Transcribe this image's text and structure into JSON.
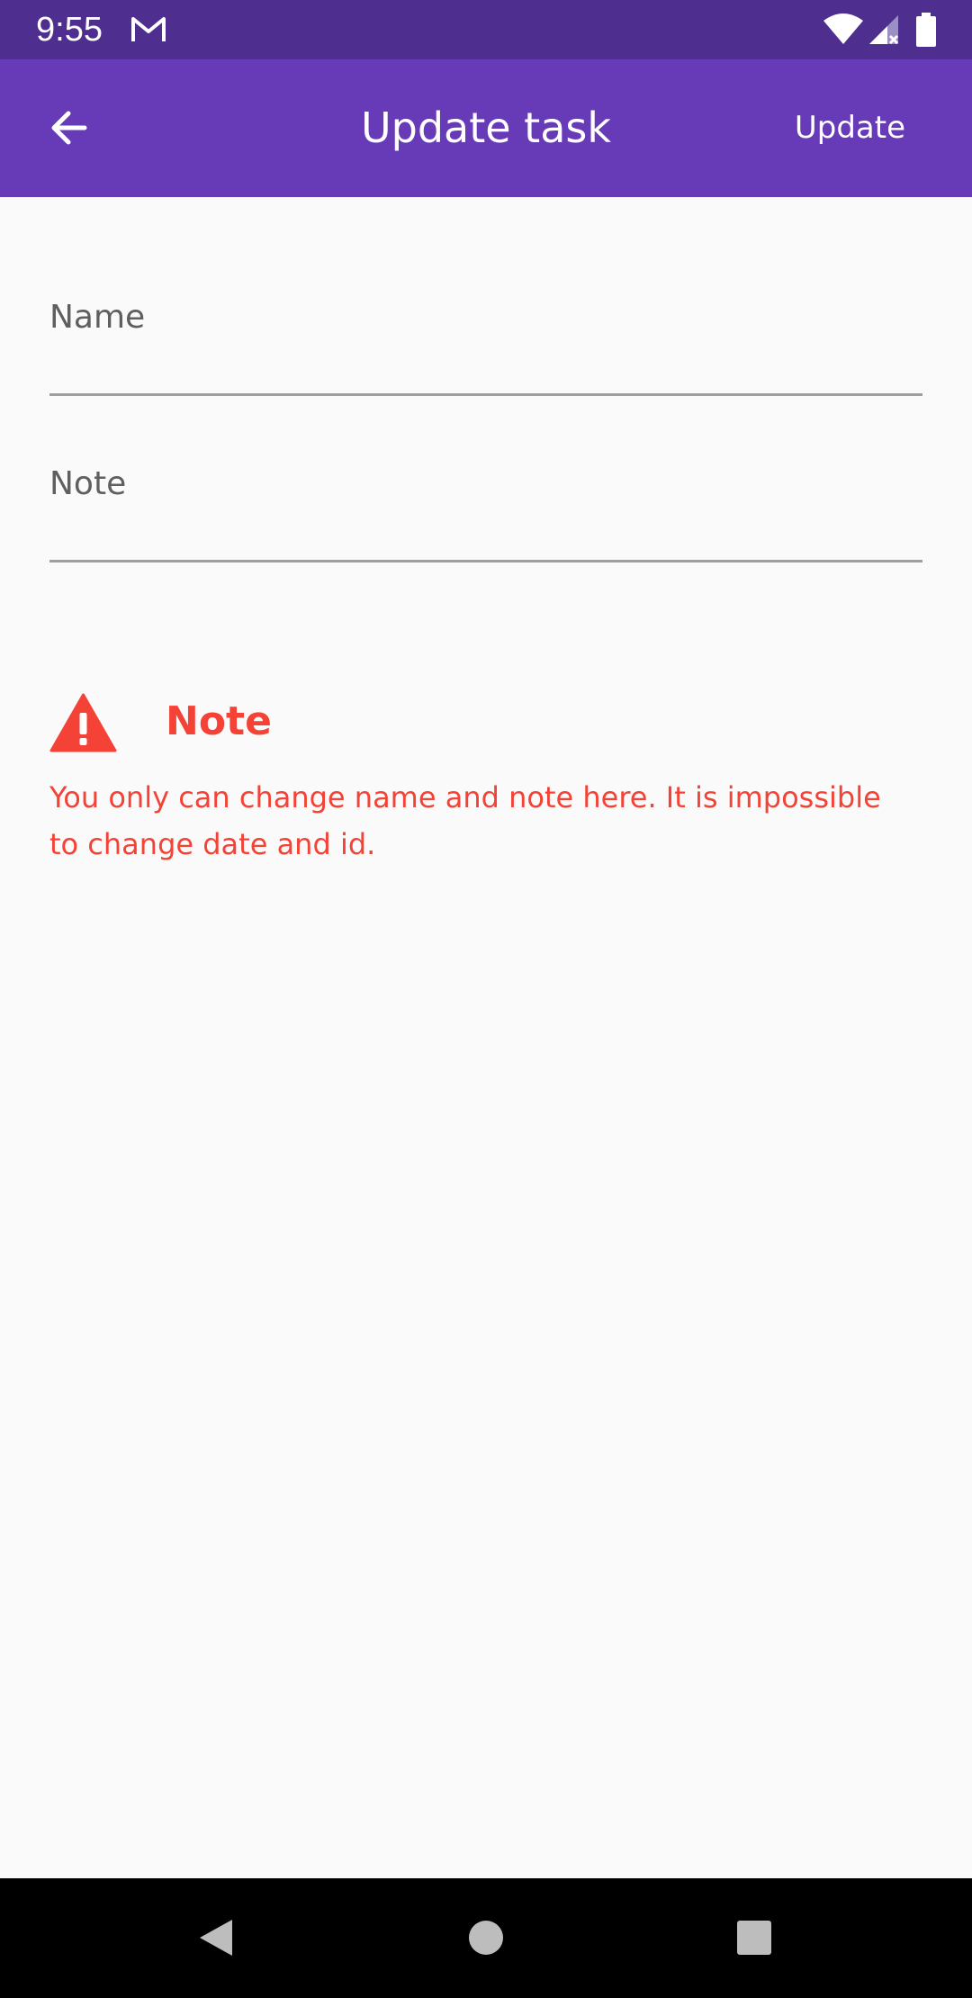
{
  "status_bar": {
    "time": "9:55",
    "icons": [
      "gmail-icon",
      "wifi-icon",
      "signal-icon",
      "battery-icon"
    ]
  },
  "app_bar": {
    "title": "Update task",
    "action_label": "Update",
    "back_icon": "arrow-back-icon",
    "color": "#673ab7"
  },
  "form": {
    "name": {
      "label": "Name",
      "value": ""
    },
    "note": {
      "label": "Note",
      "value": ""
    }
  },
  "warning": {
    "icon": "warning-icon",
    "title": "Note",
    "text": "You only can change name and note here. It is impossible to change date and id.",
    "color": "#f44336"
  },
  "nav_bar": {
    "icons": [
      "nav-back-icon",
      "nav-home-icon",
      "nav-recents-icon"
    ]
  }
}
